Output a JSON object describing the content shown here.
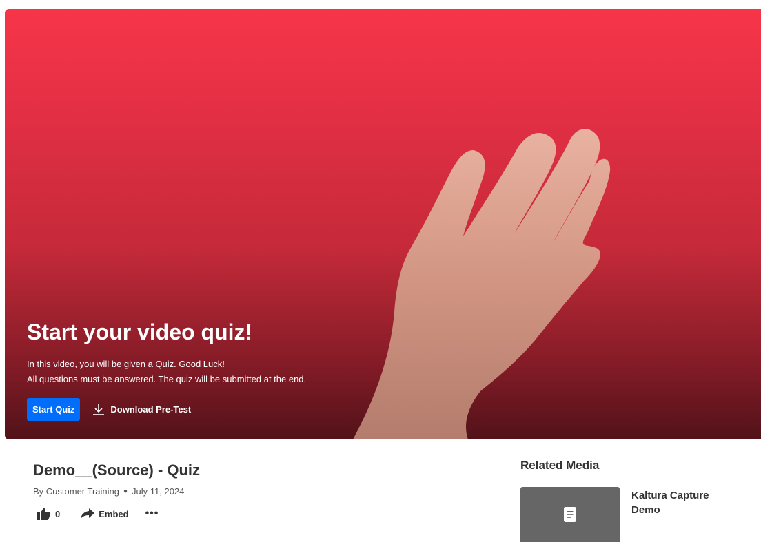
{
  "quiz": {
    "title": "Start your video quiz!",
    "line1": "In this video, you will be given a Quiz. Good Luck!",
    "line2": "All questions must be answered. The quiz will be submitted at the end.",
    "start_label": "Start Quiz",
    "download_label": "Download Pre-Test"
  },
  "media": {
    "title": "Demo__(Source) - Quiz",
    "author": "By Customer Training",
    "date": "July 11, 2024",
    "likes": "0",
    "embed_label": "Embed",
    "more_label": "•••"
  },
  "related": {
    "heading": "Related Media",
    "items": [
      {
        "title": "Kaltura Capture Demo",
        "icon": "document-icon"
      }
    ]
  },
  "colors": {
    "accent": "#006efa",
    "player_top": "#f73549",
    "player_bottom": "#521219",
    "thumb": "#666666"
  }
}
